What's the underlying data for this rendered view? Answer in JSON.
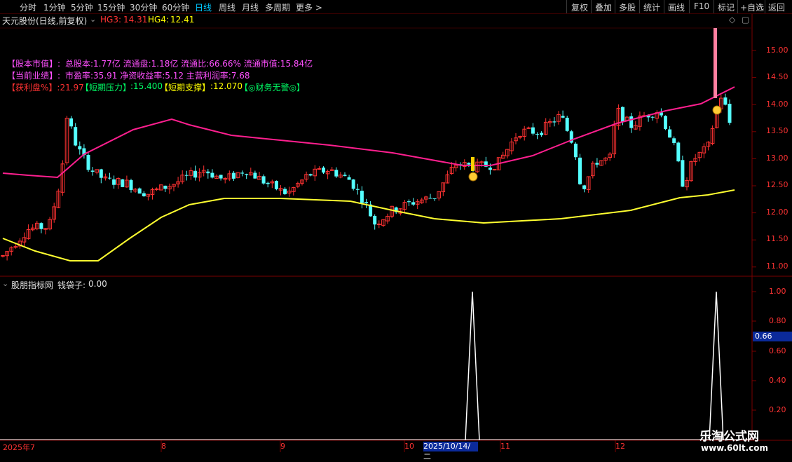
{
  "toolbar": {
    "periods": [
      "分时",
      "1分钟",
      "5分钟",
      "15分钟",
      "30分钟",
      "60分钟",
      "日线",
      "周线",
      "月线",
      "多周期",
      "更多 >"
    ],
    "active_index": 6,
    "right_buttons": [
      "复权",
      "叠加",
      "多股",
      "统计",
      "画线",
      "F10",
      "标记",
      "+自选",
      "返回"
    ]
  },
  "header": {
    "title": "天元股份(日线,前复权)",
    "hg3_label": "HG3:",
    "hg3_value": "14.31",
    "hg4_label": "HG4:",
    "hg4_value": "12.41"
  },
  "info": {
    "line1_tag": "【股本市值】:",
    "line1_text": "总股本:1.77亿 流通盘:1.18亿 流通比:66.66% 流通市值:15.84亿",
    "line2_tag": "【当前业绩】:",
    "line2_text": "市盈率:35.91 净资收益率:5.12 主营利润率:7.68",
    "line3_tag": "【获利盘%】:21.97",
    "line3_press_tag": "【短期压力】",
    "line3_press_val": ":15.400",
    "line3_support_tag": "【短期支撑】",
    "line3_support_val": ":12.070",
    "line3_fin": "【◎财务无警◎】"
  },
  "sub_panel": {
    "title": "股朋指标网",
    "indicator_label": "钱袋子:",
    "indicator_value": "0.00",
    "cursor_value": "0.66"
  },
  "y_axis_main": [
    "15.00",
    "14.50",
    "14.00",
    "13.50",
    "13.00",
    "12.50",
    "12.00",
    "11.50",
    "11.00"
  ],
  "y_axis_sub": [
    "1.00",
    "0.80",
    "0.60",
    "0.40",
    "0.20"
  ],
  "x_axis": [
    "2025年7",
    "8",
    "9",
    "10",
    "11",
    "12"
  ],
  "x_selected": "2025/10/14/二",
  "watermark": {
    "line1": "乐淘公式网",
    "line2": "www.60lt.com"
  },
  "colors": {
    "up": "#ff3232",
    "down": "#54ffff",
    "ma_pink": "#ff1f8f",
    "ma_yellow": "#ffff30",
    "grid": "#7a0000"
  }
}
